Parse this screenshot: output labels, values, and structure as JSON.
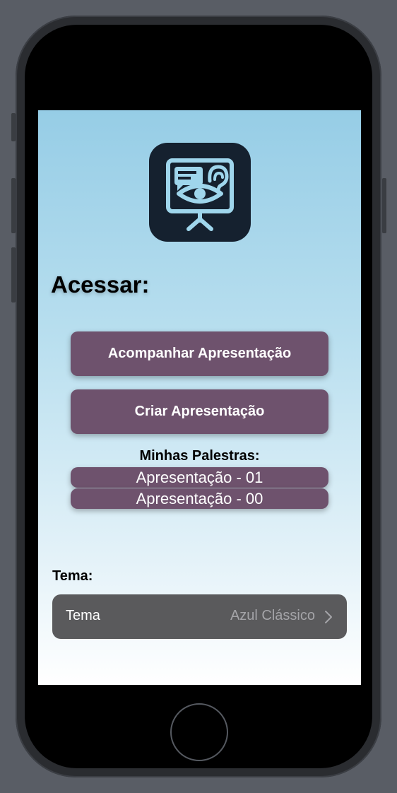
{
  "header": {
    "title": "Acessar:"
  },
  "app_icon": {
    "icon": "presentation-speech-ear-eye-icon",
    "color": "#15212f",
    "accent": "#9fd6ec"
  },
  "actions": {
    "follow_label": "Acompanhar Apresentação",
    "create_label": "Criar Apresentação",
    "color": "#6e526d"
  },
  "talks": {
    "heading": "Minhas Palestras:",
    "items": [
      {
        "label": "Apresentação - 01"
      },
      {
        "label": "Apresentação - 00"
      }
    ]
  },
  "theme": {
    "section_label": "Tema:",
    "row_label": "Tema",
    "value": "Azul Clássico",
    "icon": "chevron-right-icon"
  }
}
